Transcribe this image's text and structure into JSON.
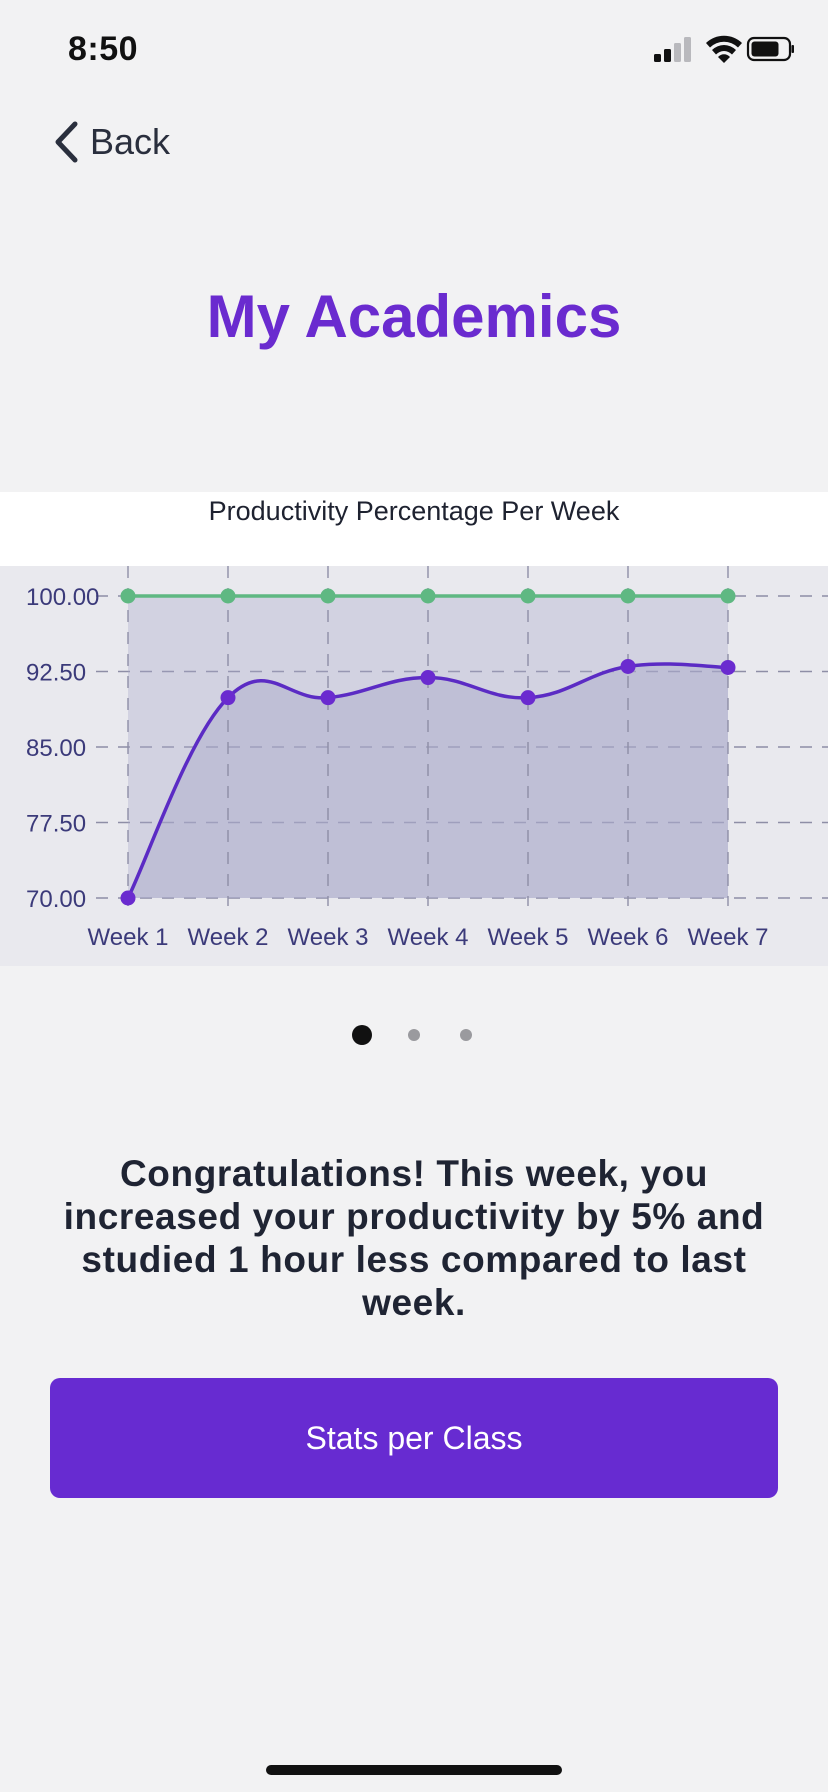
{
  "status_bar": {
    "time": "8:50",
    "icons": [
      "signal-icon",
      "wifi-icon",
      "battery-icon"
    ]
  },
  "nav": {
    "back_label": "Back",
    "back_icon": "chevron-left-icon"
  },
  "page": {
    "title": "My Academics"
  },
  "message": "Congratulations! This week, you increased your productivity by 5% and studied 1 hour less compared to last week.",
  "cta": {
    "label": "Stats per Class"
  },
  "pager": {
    "count": 3,
    "active": 0
  },
  "colors": {
    "accent": "#6a2bcf",
    "button": "#672bd1",
    "line_primary": "#5b2bc4",
    "line_target": "#5fb882",
    "fill": "#a9a9c9",
    "axis_text": "#3b3a7a"
  },
  "chart_data": {
    "type": "line",
    "title": "Productivity Percentage Per Week",
    "categories": [
      "Week 1",
      "Week 2",
      "Week 3",
      "Week 4",
      "Week 5",
      "Week 6",
      "Week 7"
    ],
    "y_ticks": [
      "100.00",
      "92.50",
      "85.00",
      "77.50",
      "70.00"
    ],
    "ylim": [
      70,
      100
    ],
    "grid": true,
    "series": [
      {
        "values": [
          70,
          89.9,
          89.9,
          91.9,
          89.9,
          93.0,
          92.9
        ],
        "area_fill": true
      },
      {
        "values": [
          100,
          100,
          100,
          100,
          100,
          100,
          100
        ]
      }
    ]
  }
}
